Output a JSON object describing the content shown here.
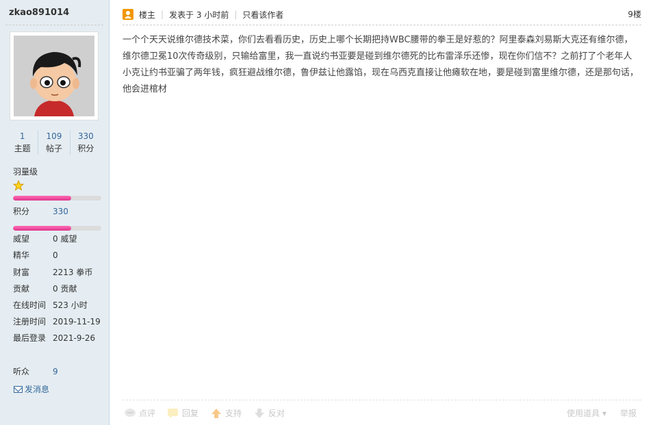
{
  "user": {
    "name": "zkao891014",
    "stats": [
      {
        "value": "1",
        "label": "主题"
      },
      {
        "value": "109",
        "label": "帖子"
      },
      {
        "value": "330",
        "label": "积分"
      }
    ],
    "level": "羽量级",
    "bar1_fill": 0.66,
    "bar2_fill": 0.66,
    "info": {
      "points": {
        "key": "积分",
        "value": "330"
      },
      "prestige": {
        "key": "威望",
        "value": "0 威望"
      },
      "elite": {
        "key": "精华",
        "value": "0"
      },
      "wealth": {
        "key": "财富",
        "value": "2213 拳币"
      },
      "contribution": {
        "key": "贡献",
        "value": "0 贡献"
      },
      "online": {
        "key": "在线时间",
        "value": "523 小时"
      },
      "register": {
        "key": "注册时间",
        "value": "2019-11-19"
      },
      "last_login": {
        "key": "最后登录",
        "value": "2021-9-26"
      },
      "listeners": {
        "key": "听众",
        "value": "9"
      }
    },
    "send_message": "发消息"
  },
  "post": {
    "owner_label": "楼主",
    "posted": "发表于 3 小时前",
    "only_author": "只看该作者",
    "floor": "9楼",
    "content": "一个个天天说维尔德技术菜，你们去看看历史，历史上哪个长期把持WBC腰带的拳王是好惹的？阿里泰森刘易斯大克还有维尔德，维尔德卫冕10次传奇级别，只输给富里，我一直说约书亚要是碰到维尔德死的比布雷泽乐还惨，现在你们信不？之前打了个老年人小克让约书亚骗了两年钱，疯狂避战维尔德，鲁伊兹让他露馅，现在乌西克直接让他瘫软在地，要是碰到富里维尔德，还是那句话，他会进棺材",
    "actions": {
      "rate": "点评",
      "reply": "回复",
      "support": "支持",
      "oppose": "反对",
      "tools": "使用道具",
      "report": "举报"
    }
  },
  "colors": {
    "sidebar_bg": "#e5edf2",
    "link": "#336699",
    "bar": "#e0358c"
  }
}
